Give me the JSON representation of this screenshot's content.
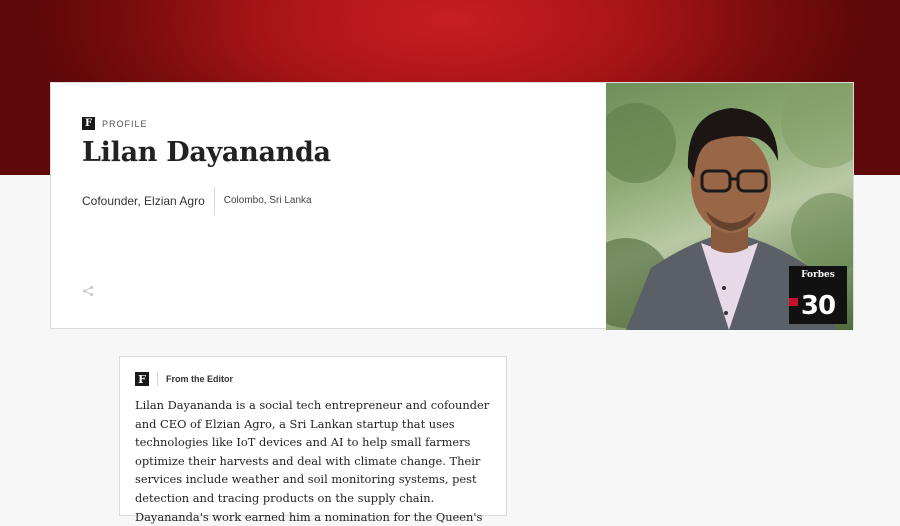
{
  "profile": {
    "section_label": "PROFILE",
    "brand_letter": "F",
    "name": "Lilan Dayananda",
    "title": "Cofounder, Elzian Agro",
    "location": "Colombo, Sri Lanka"
  },
  "photo": {
    "badge_brand": "Forbes",
    "badge_number": "30"
  },
  "editor": {
    "brand_letter": "F",
    "label": "From the Editor",
    "text": "Lilan Dayananda is a social tech entrepreneur and cofounder and CEO of Elzian Agro, a Sri Lankan startup that uses technologies like IoT devices and AI to help small farmers optimize their harvests and deal with climate change. Their services include weather and soil monitoring systems, pest detection and tracing products on the supply chain. Dayananda's work earned him a nomination for the Queen's"
  },
  "colors": {
    "brand_red": "#b3181b",
    "ink": "#222222"
  }
}
